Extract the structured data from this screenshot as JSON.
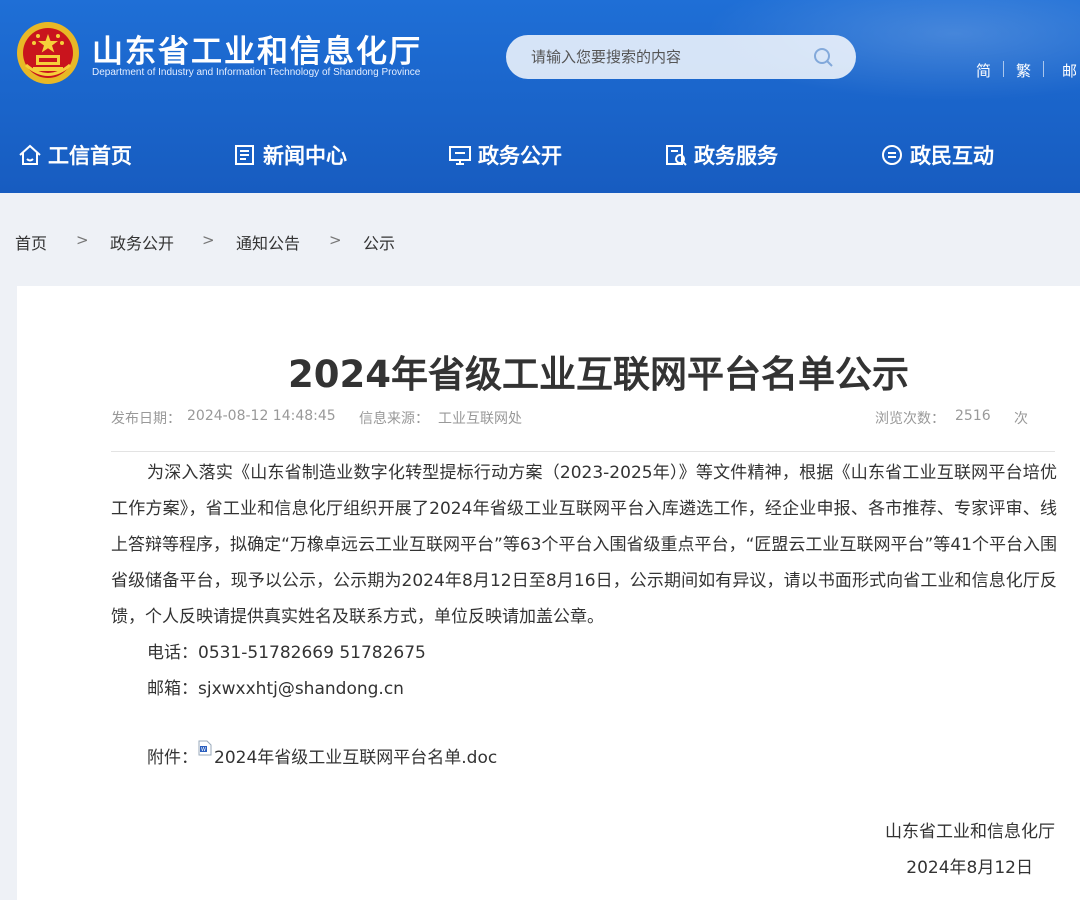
{
  "header": {
    "site_title": "山东省工业和信息化厅",
    "site_subtitle": "Department of Industry and Information Technology of Shandong Province",
    "search": {
      "placeholder": "请输入您要搜索的内容"
    },
    "lang": {
      "simplified": "简",
      "traditional": "繁",
      "mail": "邮"
    }
  },
  "nav": [
    {
      "label": "工信首页",
      "icon": "home-icon"
    },
    {
      "label": "新闻中心",
      "icon": "news-icon"
    },
    {
      "label": "政务公开",
      "icon": "monitor-icon"
    },
    {
      "label": "政务服务",
      "icon": "service-icon"
    },
    {
      "label": "政民互动",
      "icon": "interact-icon"
    }
  ],
  "breadcrumb": [
    "首页",
    "政务公开",
    "通知公告",
    "公示"
  ],
  "breadcrumb_separator": ">",
  "article": {
    "title": "2024年省级工业互联网平台名单公示",
    "publish_label": "发布日期：",
    "publish_date": "2024-08-12 14:48:45",
    "source_label": "信息来源：",
    "source": "工业互联网处",
    "views_label": "浏览次数：",
    "views": "2516",
    "views_unit": "次",
    "paragraph": "为深入落实《山东省制造业数字化转型提标行动方案（2023-2025年）》等文件精神，根据《山东省工业互联网平台培优工作方案》，省工业和信息化厅组织开展了2024年省级工业互联网平台入库遴选工作，经企业申报、各市推荐、专家评审、线上答辩等程序，拟确定“万橡卓远云工业互联网平台”等63个平台入围省级重点平台，“匠盟云工业互联网平台”等41个平台入围省级储备平台，现予以公示，公示期为2024年8月12日至8月16日，公示期间如有异议，请以书面形式向省工业和信息化厅反馈，个人反映请提供真实姓名及联系方式，单位反映请加盖公章。",
    "phone": "电话：0531-51782669 51782675",
    "email": "邮箱：sjxwxxhtj@shandong.cn",
    "attachment_label": "附件：",
    "attachment_file": "2024年省级工业互联网平台名单.doc",
    "signature_org": "山东省工业和信息化厅",
    "signature_date": "2024年8月12日"
  },
  "colors": {
    "header_blue": "#1b66cc",
    "page_bg": "#eef1f6",
    "meta_gray": "#999999"
  }
}
